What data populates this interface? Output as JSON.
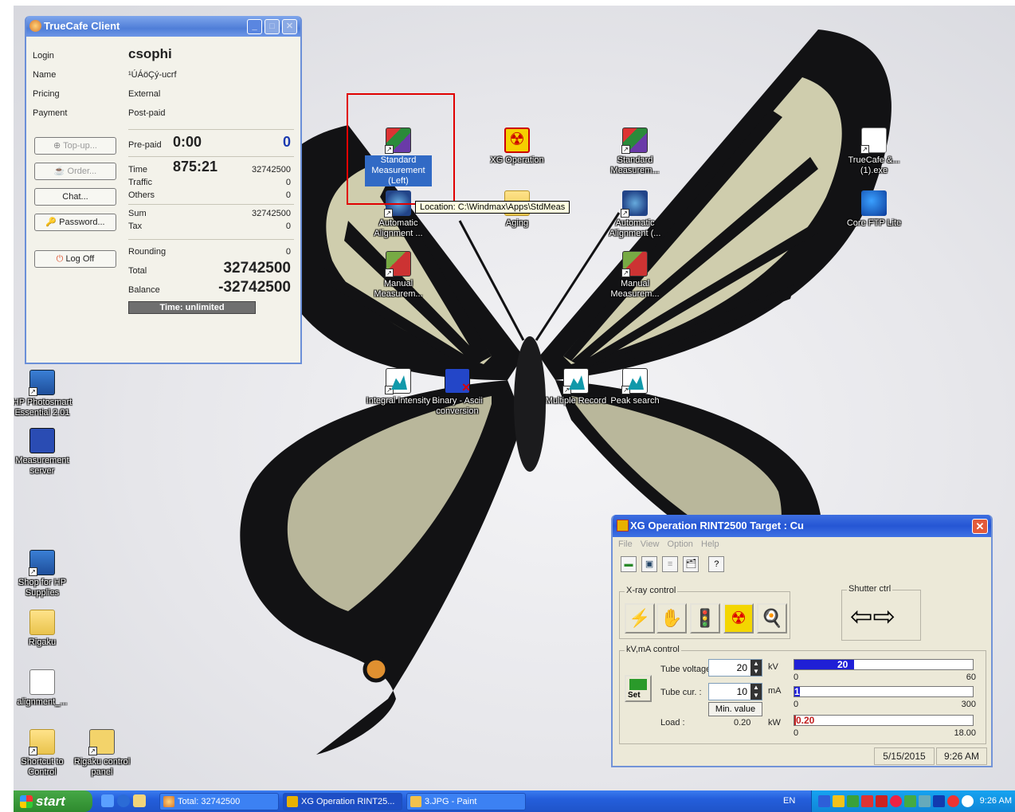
{
  "desktop": {
    "icons": {
      "standard_left": "Standard Measurement (Left)",
      "xg_operation": "XG Operation",
      "standard_right": "Standard Measurem...",
      "truecafe": "TrueCafe &...(1).exe",
      "auto_align_left": "Automatic Alignment ...",
      "aging": "Aging",
      "auto_align_right": "Automatic Alignment (...",
      "core_ftp": "Core FTP Lite",
      "manual_left": "Manual Measurem...",
      "manual_right": "Manual Measurem...",
      "integral": "Integral Intensity",
      "binary": "Binary - Ascii conversion",
      "multiple": "Multiple Record",
      "peak": "Peak search",
      "hp_photosmart": "HP Photosmart Essential 2.01",
      "measurement_server": "Measurement server",
      "shop_hp": "Shop for HP Supplies",
      "rigaku": "Rigaku",
      "alignment": "alignment_...",
      "shortcut_control": "Shortcut to Control",
      "rigaku_control": "Rigaku control panel"
    },
    "tooltip": "Location: C:\\Windmax\\Apps\\StdMeas"
  },
  "truecafe": {
    "title": "TrueCafe Client",
    "info": {
      "login_label": "Login",
      "login_value": "csophi",
      "name_label": "Name",
      "name_value": "¹ÚÁöÇý-ucrf",
      "pricing_label": "Pricing",
      "pricing_value": "External",
      "payment_label": "Payment",
      "payment_value": "Post-paid"
    },
    "buttons": {
      "topup": "Top-up...",
      "order": "Order...",
      "chat": "Chat...",
      "password": "Password...",
      "logoff": "Log Off"
    },
    "prepaid": {
      "label": "Pre-paid",
      "time": "0:00",
      "amount": "0"
    },
    "time": {
      "label": "Time",
      "value": "875:21",
      "amount": "32742500"
    },
    "traffic": {
      "label": "Traffic",
      "amount": "0"
    },
    "others": {
      "label": "Others",
      "amount": "0"
    },
    "sum": {
      "label": "Sum",
      "amount": "32742500"
    },
    "tax": {
      "label": "Tax",
      "amount": "0"
    },
    "rounding": {
      "label": "Rounding",
      "amount": "0"
    },
    "total": {
      "label": "Total",
      "amount": "32742500"
    },
    "balance": {
      "label": "Balance",
      "amount": "-32742500"
    },
    "time_status": "Time: unlimited"
  },
  "xg": {
    "title": "XG Operation RINT2500  Target : Cu",
    "menu": [
      "File",
      "View",
      "Option",
      "Help"
    ],
    "xray_label": "X-ray control",
    "shutter_label": "Shutter ctrl",
    "kvma_label": "kV,mA control",
    "tube_voltage_label": "Tube voltage :",
    "tube_voltage_value": "20",
    "kv_unit": "kV",
    "tube_current_label": "Tube cur. :",
    "tube_current_value": "10",
    "ma_unit": "mA",
    "min_value_btn": "Min. value",
    "set_btn": "Set",
    "load_label": "Load :",
    "load_value": "0.20",
    "kw_unit": "kW",
    "bar_kv": {
      "value": 20,
      "label": "20",
      "min": "0",
      "max": "60",
      "fraction": 0.333
    },
    "bar_ma": {
      "value": 10,
      "label": "10",
      "min": "0",
      "max": "300",
      "fraction": 0.033
    },
    "bar_kw": {
      "value": 0.2,
      "label": "0.20",
      "min": "0",
      "max": "18.00",
      "fraction": 0.011
    },
    "date": "5/15/2015",
    "time": "9:26 AM"
  },
  "taskbar": {
    "start": "start",
    "tasks": [
      "Total: 32742500",
      "XG Operation RINT25...",
      "3.JPG - Paint"
    ],
    "lang": "EN",
    "clock": "9:26 AM"
  }
}
